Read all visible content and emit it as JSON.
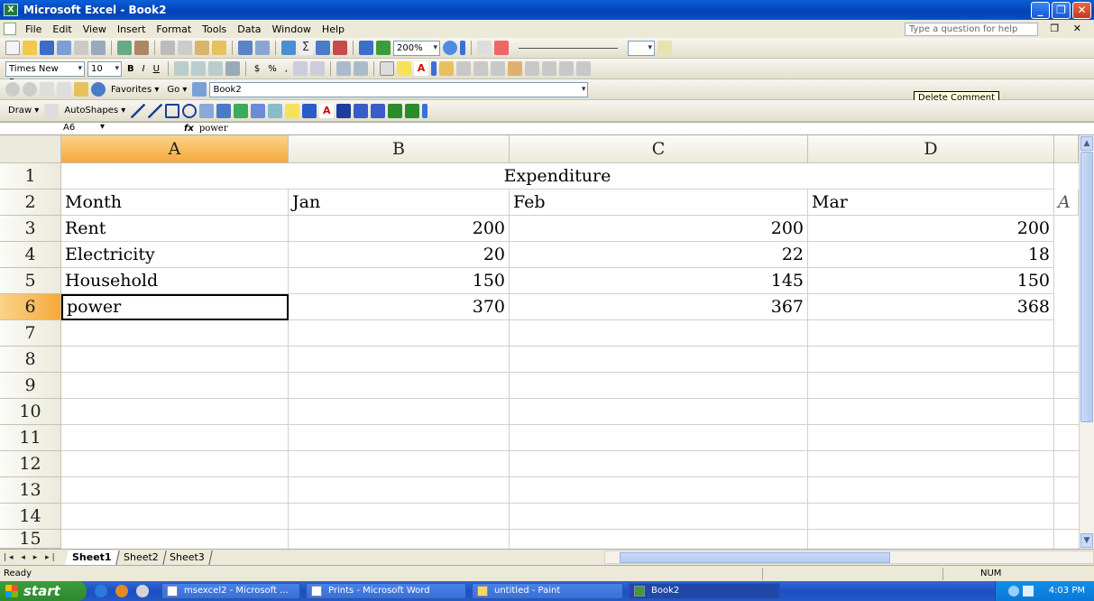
{
  "window": {
    "title": "Microsoft Excel - Book2"
  },
  "menu": [
    "File",
    "Edit",
    "View",
    "Insert",
    "Format",
    "Tools",
    "Data",
    "Window",
    "Help"
  ],
  "ask_placeholder": "Type a question for help",
  "toolbar1": {
    "zoom": "200%"
  },
  "toolbar2": {
    "font": "Times New Roman",
    "size": "10"
  },
  "toolbar3": {
    "favorites": "Favorites ▾",
    "go": "Go ▾",
    "address": "Book2"
  },
  "toolbar4": {
    "draw": "Draw ▾",
    "autoshapes": "AutoShapes ▾"
  },
  "tooltip": "Delete Comment",
  "formula": {
    "namebox": "A6",
    "fx": "fx",
    "value": "power"
  },
  "columns": [
    "A",
    "B",
    "C",
    "D"
  ],
  "rows": [
    "1",
    "2",
    "3",
    "4",
    "5",
    "6",
    "7",
    "8",
    "9",
    "10",
    "11",
    "12",
    "13",
    "14",
    "15"
  ],
  "cells": {
    "title": "Expenditure",
    "r2": [
      "Month",
      "Jan",
      "Feb",
      "Mar",
      "A"
    ],
    "r3": [
      "Rent",
      "200",
      "200",
      "200"
    ],
    "r4": [
      "Electricity",
      "20",
      "22",
      "18"
    ],
    "r5": [
      "Household",
      "150",
      "145",
      "150"
    ],
    "r6": [
      "power",
      "370",
      "367",
      "368"
    ]
  },
  "sheets": [
    "Sheet1",
    "Sheet2",
    "Sheet3"
  ],
  "status": {
    "left": "Ready",
    "num": "NUM"
  },
  "taskbar": {
    "start": "start",
    "items": [
      "msexcel2 - Microsoft ...",
      "Prints - Microsoft Word",
      "untitled - Paint",
      "Book2"
    ],
    "clock": "4:03 PM"
  }
}
